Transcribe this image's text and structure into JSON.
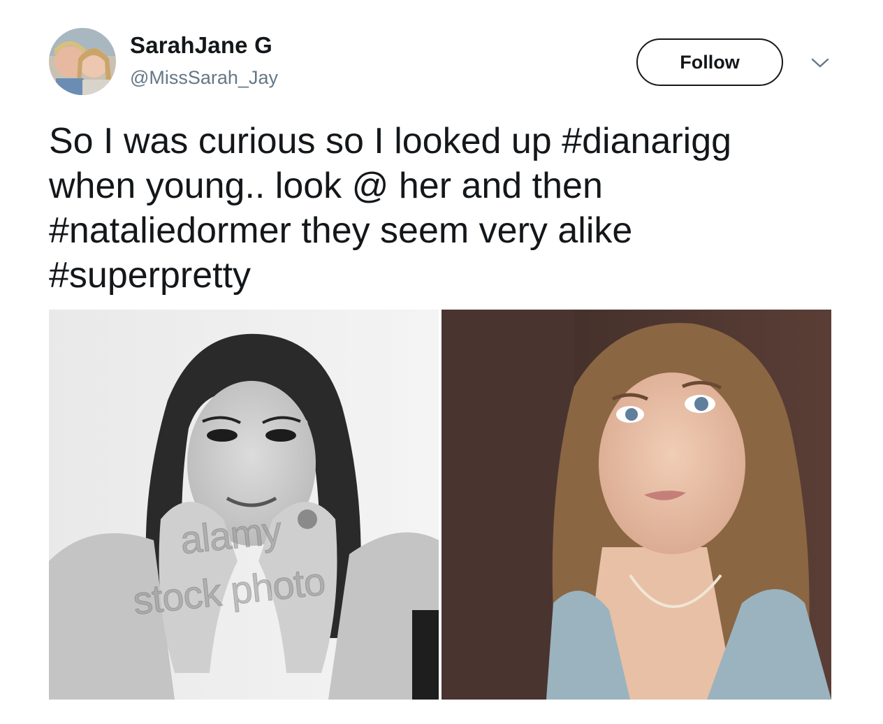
{
  "tweet": {
    "author": {
      "display_name": "SarahJane G",
      "handle": "@MissSarah_Jay"
    },
    "follow_label": "Follow",
    "menu_icon": "chevron-down-icon",
    "text_segments": [
      {
        "type": "text",
        "value": "So I was curious so I looked up "
      },
      {
        "type": "hashtag",
        "value": "#dianarigg"
      },
      {
        "type": "text",
        "value": "\nwhen young.. look @ her and then\n"
      },
      {
        "type": "hashtag",
        "value": "#nataliedormer"
      },
      {
        "type": "text",
        "value": " they seem very alike\n"
      },
      {
        "type": "hashtag",
        "value": "#superpretty"
      }
    ],
    "media": {
      "photo1_watermark_line1": "alamy",
      "photo1_watermark_line2": "stock photo"
    }
  },
  "colors": {
    "text": "#14171a",
    "secondary_text": "#657786",
    "background": "#ffffff"
  }
}
